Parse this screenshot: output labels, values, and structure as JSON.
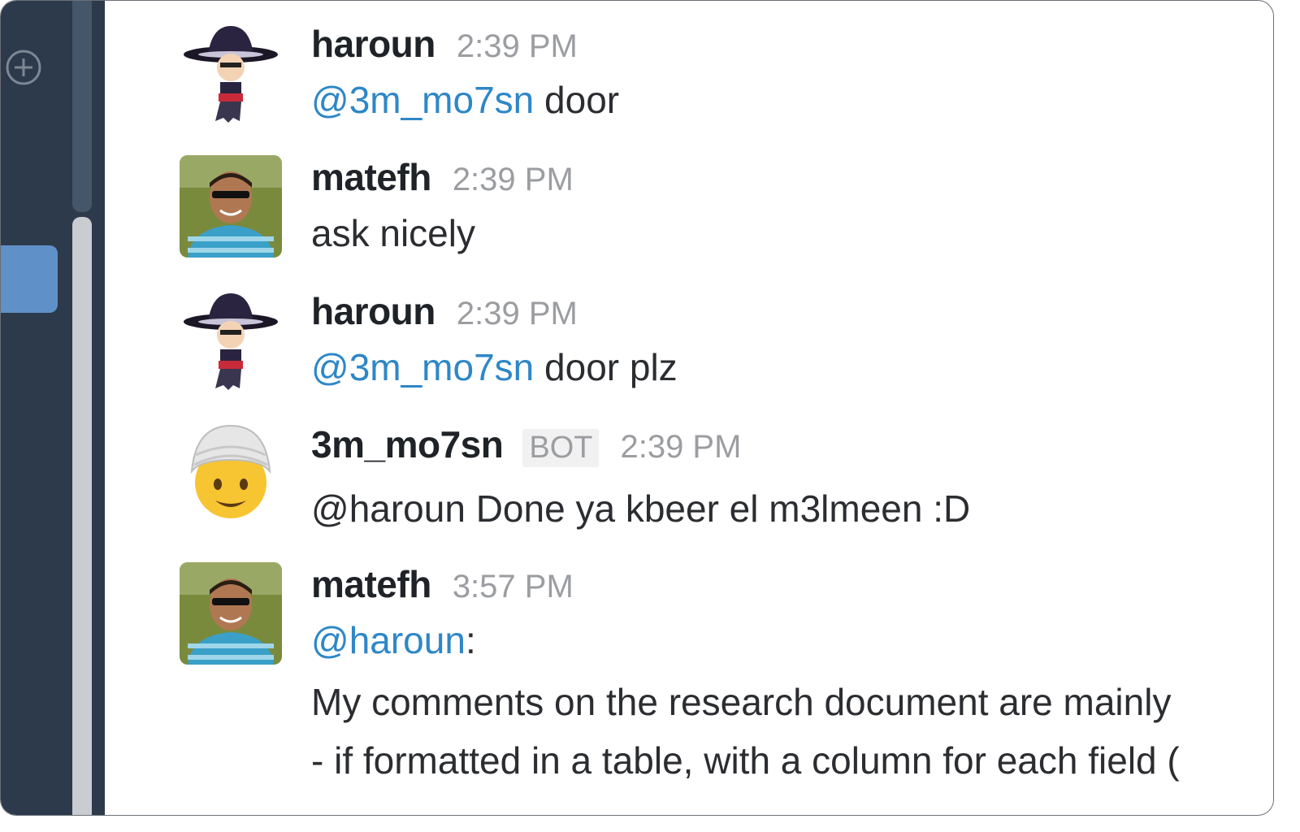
{
  "sidebar": {
    "add_icon": "plus-circle-icon",
    "accent_color": "#5f91c8"
  },
  "messages": [
    {
      "author": "haroun",
      "time": "2:39 PM",
      "avatar": "haroun-avatar",
      "mention": "@3m_mo7sn",
      "text": " door"
    },
    {
      "author": "matefh",
      "time": "2:39 PM",
      "avatar": "matefh-avatar",
      "text": "ask nicely"
    },
    {
      "author": "haroun",
      "time": "2:39 PM",
      "avatar": "haroun-avatar",
      "mention": "@3m_mo7sn",
      "text": " door plz"
    },
    {
      "author": "3m_mo7sn",
      "badge": "BOT",
      "time": "2:39 PM",
      "avatar": "turban-emoji-avatar",
      "text": "@haroun Done ya kbeer el m3lmeen :D"
    },
    {
      "author": "matefh",
      "time": "3:57 PM",
      "avatar": "matefh-avatar",
      "mention": "@haroun",
      "mention_suffix": ":",
      "line2": "My comments on the research document are mainly",
      "line3": "- if formatted in a table, with a column for each field ("
    }
  ],
  "colors": {
    "mention": "#2e87c7",
    "sidebar_bg": "#2c3a4c",
    "timestamp": "#9b9da1"
  }
}
